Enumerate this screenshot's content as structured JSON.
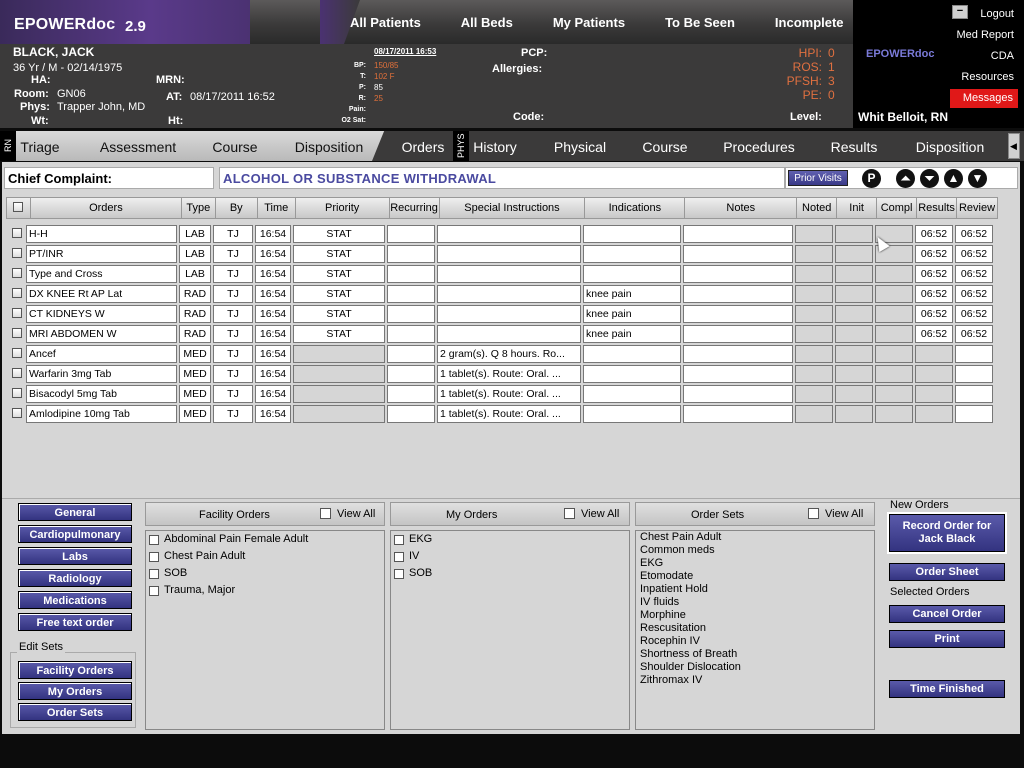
{
  "app": {
    "name": "EPOWERdoc",
    "version": "2.9"
  },
  "topnav": [
    "All Patients",
    "All Beds",
    "My Patients",
    "To Be Seen",
    "Incomplete"
  ],
  "patient": {
    "name": "BLACK, JACK",
    "age_sex_dob": "36 Yr / M  -  02/14/1975",
    "ha_label": "HA:",
    "room_label": "Room:",
    "room": "GN06",
    "phys_label": "Phys:",
    "phys": "Trapper John, MD",
    "wt_label": "Wt:",
    "mrn_label": "MRN:",
    "at_label": "AT:",
    "at": "08/17/2011 16:52",
    "ht_label": "Ht:",
    "vitals_date": "08/17/2011 16:53",
    "vitals": [
      {
        "label": "BP:",
        "value": "150/85"
      },
      {
        "label": "T:",
        "value": "102 F"
      },
      {
        "label": "P:",
        "value": "85"
      },
      {
        "label": "R:",
        "value": "25"
      },
      {
        "label": "Pain:",
        "value": ""
      },
      {
        "label": "O2 Sat:",
        "value": ""
      }
    ],
    "pcp_label": "PCP:",
    "allergies_label": "Allergies:",
    "code_label": "Code:",
    "level_label": "Level:",
    "scores": [
      {
        "label": "HPI:",
        "value": "0"
      },
      {
        "label": "ROS:",
        "value": "1"
      },
      {
        "label": "PFSH:",
        "value": "3"
      },
      {
        "label": "PE:",
        "value": "0"
      }
    ]
  },
  "right_panel": {
    "logo": "EPOWERdoc",
    "minimize": "−",
    "logout": "Logout",
    "med_report": "Med Report",
    "cda": "CDA",
    "resources": "Resources",
    "messages": "Messages",
    "user": "Whit Belloit, RN"
  },
  "tabs": {
    "rn_label": "RN",
    "phys_label": "PHYS",
    "rn": [
      "Triage",
      "Assessment",
      "Course",
      "Disposition",
      "Orders"
    ],
    "phys": [
      "History",
      "Physical",
      "Course",
      "Procedures",
      "Results",
      "Disposition"
    ],
    "active": "Orders"
  },
  "chief_complaint": {
    "label": "Chief Complaint:",
    "value": "ALCOHOL OR SUBSTANCE WITHDRAWAL",
    "prior_visits": "Prior Visits"
  },
  "toolbar_icons": {
    "p": "P",
    "up_outline": "⏶",
    "down_outline": "⏷",
    "up": "▲",
    "down": "▼"
  },
  "orders_table": {
    "columns": [
      "Orders",
      "Type",
      "By",
      "Time",
      "Priority",
      "Recurring",
      "Special Instructions",
      "Indications",
      "Notes",
      "Noted",
      "Init",
      "Compl",
      "Results",
      "Review"
    ],
    "rows": [
      {
        "order": "H-H",
        "type": "LAB",
        "by": "TJ",
        "time": "16:54",
        "priority": "STAT",
        "recurring": "",
        "special": "",
        "indications": "",
        "notes": "",
        "noted": "",
        "init": "",
        "compl": "",
        "results": "06:52",
        "review": "06:52"
      },
      {
        "order": "PT/INR",
        "type": "LAB",
        "by": "TJ",
        "time": "16:54",
        "priority": "STAT",
        "recurring": "",
        "special": "",
        "indications": "",
        "notes": "",
        "noted": "",
        "init": "",
        "compl": "",
        "results": "06:52",
        "review": "06:52"
      },
      {
        "order": "Type and Cross",
        "type": "LAB",
        "by": "TJ",
        "time": "16:54",
        "priority": "STAT",
        "recurring": "",
        "special": "",
        "indications": "",
        "notes": "",
        "noted": "",
        "init": "",
        "compl": "",
        "results": "06:52",
        "review": "06:52"
      },
      {
        "order": "DX KNEE Rt AP  Lat",
        "type": "RAD",
        "by": "TJ",
        "time": "16:54",
        "priority": "STAT",
        "recurring": "",
        "special": "",
        "indications": "knee pain",
        "notes": "",
        "noted": "",
        "init": "",
        "compl": "",
        "results": "06:52",
        "review": "06:52"
      },
      {
        "order": "CT KIDNEYS W",
        "type": "RAD",
        "by": "TJ",
        "time": "16:54",
        "priority": "STAT",
        "recurring": "",
        "special": "",
        "indications": "knee pain",
        "notes": "",
        "noted": "",
        "init": "",
        "compl": "",
        "results": "06:52",
        "review": "06:52"
      },
      {
        "order": "MRI ABDOMEN W",
        "type": "RAD",
        "by": "TJ",
        "time": "16:54",
        "priority": "STAT",
        "recurring": "",
        "special": "",
        "indications": "knee pain",
        "notes": "",
        "noted": "",
        "init": "",
        "compl": "",
        "results": "06:52",
        "review": "06:52"
      },
      {
        "order": "Ancef",
        "type": "MED",
        "by": "TJ",
        "time": "16:54",
        "priority": "",
        "recurring": "",
        "special": "2 gram(s).  Q 8 hours. Ro...",
        "indications": "",
        "notes": "",
        "noted": "",
        "init": "",
        "compl": "",
        "results": "",
        "review": ""
      },
      {
        "order": "Warfarin 3mg Tab",
        "type": "MED",
        "by": "TJ",
        "time": "16:54",
        "priority": "",
        "recurring": "",
        "special": "1 tablet(s).  Route: Oral. ...",
        "indications": "",
        "notes": "",
        "noted": "",
        "init": "",
        "compl": "",
        "results": "",
        "review": ""
      },
      {
        "order": "Bisacodyl 5mg Tab",
        "type": "MED",
        "by": "TJ",
        "time": "16:54",
        "priority": "",
        "recurring": "",
        "special": "1 tablet(s).  Route: Oral. ...",
        "indications": "",
        "notes": "",
        "noted": "",
        "init": "",
        "compl": "",
        "results": "",
        "review": ""
      },
      {
        "order": "Amlodipine 10mg Tab",
        "type": "MED",
        "by": "TJ",
        "time": "16:54",
        "priority": "",
        "recurring": "",
        "special": "1 tablet(s).  Route: Oral. ...",
        "indications": "",
        "notes": "",
        "noted": "",
        "init": "",
        "compl": "",
        "results": "",
        "review": ""
      }
    ]
  },
  "categories": [
    "General",
    "Cardiopulmonary",
    "Labs",
    "Radiology",
    "Medications",
    "Free text order"
  ],
  "edit_sets": {
    "label": "Edit Sets",
    "buttons": [
      "Facility Orders",
      "My Orders",
      "Order Sets"
    ]
  },
  "facility_orders": {
    "title": "Facility Orders",
    "view_all": "View All",
    "items": [
      "Abdominal Pain Female Adult",
      "Chest Pain Adult",
      "SOB",
      "Trauma, Major"
    ]
  },
  "my_orders": {
    "title": "My Orders",
    "view_all": "View All",
    "items": [
      "EKG",
      "IV",
      "SOB"
    ]
  },
  "order_sets": {
    "title": "Order Sets",
    "view_all": "View All",
    "items": [
      "Chest Pain Adult",
      "Common meds",
      "EKG",
      "Etomodate",
      "Inpatient Hold",
      "IV fluids",
      "Morphine",
      "Rescusitation",
      "Rocephin IV",
      "Shortness of Breath",
      "Shoulder Dislocation",
      "Zithromax IV"
    ]
  },
  "right_actions": {
    "new_orders_label": "New Orders",
    "record_order": "Record Order for Jack Black",
    "order_sheet": "Order Sheet",
    "selected_orders_label": "Selected Orders",
    "cancel_order": "Cancel Order",
    "print": "Print",
    "time_finished": "Time Finished"
  },
  "colors": {
    "brand_purple": "#4b3272",
    "button_blue": "#333380",
    "messages_red": "#e01818",
    "vital_orange": "#e0703a"
  }
}
